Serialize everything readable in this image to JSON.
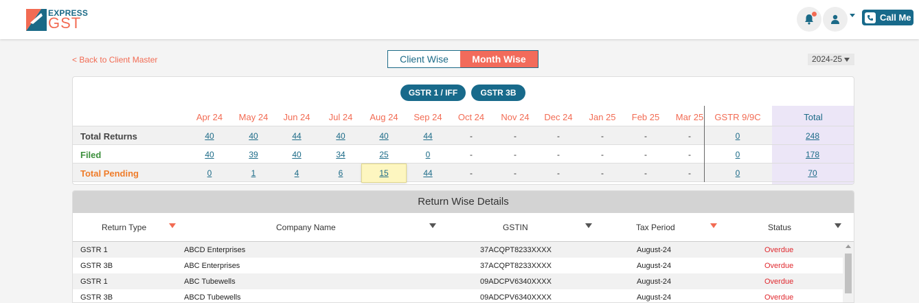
{
  "brand": {
    "line1": "EXPRESS",
    "line2": "GST"
  },
  "header": {
    "call_label": "Call Me"
  },
  "nav": {
    "back_label": "< Back to Client Master",
    "toggle_client": "Client Wise",
    "toggle_month": "Month Wise",
    "year": "2024-25"
  },
  "summary": {
    "pill1": "GSTR 1 / IFF",
    "pill2": "GSTR 3B",
    "months": [
      "Apr 24",
      "May 24",
      "Jun 24",
      "Jul 24",
      "Aug 24",
      "Sep 24",
      "Oct 24",
      "Nov 24",
      "Dec 24",
      "Jan 25",
      "Feb 25",
      "Mar 25"
    ],
    "gstr9_label": "GSTR 9/9C",
    "total_label": "Total",
    "rows": [
      {
        "label": "Total Returns",
        "values": [
          "40",
          "40",
          "44",
          "40",
          "40",
          "44",
          "-",
          "-",
          "-",
          "-",
          "-",
          "-"
        ],
        "gstr9": "0",
        "total": "248"
      },
      {
        "label": "Filed",
        "values": [
          "40",
          "39",
          "40",
          "34",
          "25",
          "0",
          "-",
          "-",
          "-",
          "-",
          "-",
          "-"
        ],
        "gstr9": "0",
        "total": "178"
      },
      {
        "label": "Total Pending",
        "values": [
          "0",
          "1",
          "4",
          "6",
          "15",
          "44",
          "-",
          "-",
          "-",
          "-",
          "-",
          "-"
        ],
        "gstr9": "0",
        "total": "70"
      }
    ]
  },
  "details": {
    "title": "Return Wise Details",
    "columns": [
      "Return Type",
      "Company Name",
      "GSTIN",
      "Tax Period",
      "Status"
    ],
    "rows": [
      {
        "type": "GSTR 1",
        "company": "ABCD Enterprises",
        "gstin": "37ACQPT8233XXXX",
        "period": "August-24",
        "status": "Overdue"
      },
      {
        "type": "GSTR 3B",
        "company": "ABC Enterprises",
        "gstin": "37ACQPT8233XXXX",
        "period": "August-24",
        "status": "Overdue"
      },
      {
        "type": "GSTR 1",
        "company": "ABC Tubewells",
        "gstin": "09ADCPV6340XXXX",
        "period": "August-24",
        "status": "Overdue"
      },
      {
        "type": "GSTR 3B",
        "company": "ABCD Tubewells",
        "gstin": "09ADCPV6340XXXX",
        "period": "August-24",
        "status": "Overdue"
      }
    ]
  },
  "colors": {
    "accent": "#f26b53",
    "primary": "#186a8b",
    "filed": "#3c8f3c",
    "pending": "#ef7c2a",
    "overdue": "#e0282e"
  }
}
